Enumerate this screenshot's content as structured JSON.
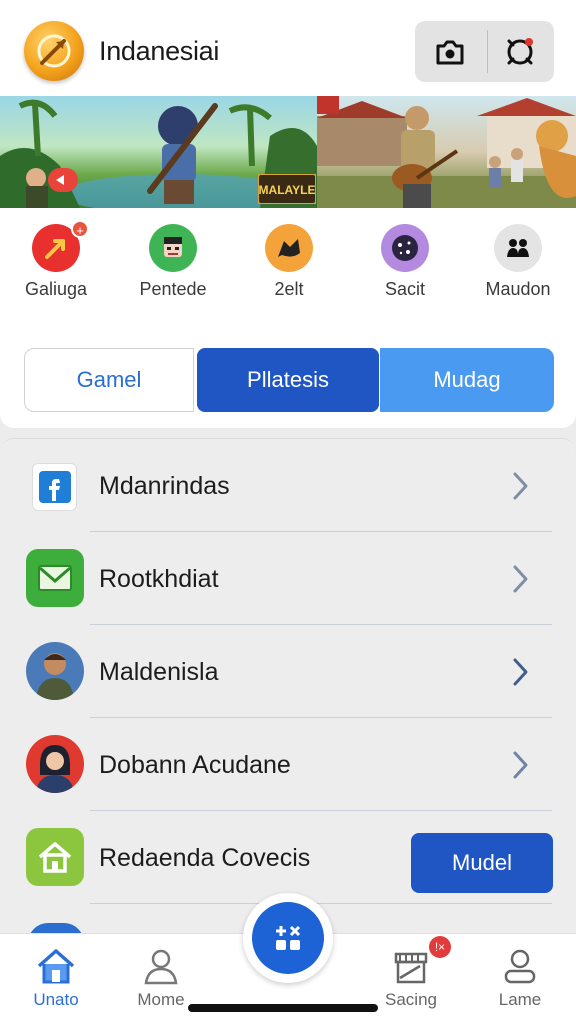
{
  "app": {
    "title": "Indanesiai"
  },
  "header": {
    "actions": [
      {
        "icon": "camera-icon"
      },
      {
        "icon": "record-icon"
      }
    ]
  },
  "banner": {
    "badge_text": "MALAYLE"
  },
  "quick_actions": [
    {
      "label": "Galiuga",
      "icon": "arrow-badge-icon",
      "color": "#e8302f",
      "badge": "+"
    },
    {
      "label": "Pentede",
      "icon": "character-icon",
      "color": "#3fb455"
    },
    {
      "label": "2elt",
      "icon": "fox-icon",
      "color": "#f3a33a"
    },
    {
      "label": "Sacit",
      "icon": "sparkle-icon",
      "color": "#b489e0"
    },
    {
      "label": "Maudon",
      "icon": "people-icon",
      "color": "#e4e4e4"
    }
  ],
  "tabs": [
    {
      "label": "Gamel"
    },
    {
      "label": "Pllatesis"
    },
    {
      "label": "Mudag"
    }
  ],
  "list": [
    {
      "label": "Mdanrindas",
      "icon": "facebook-icon"
    },
    {
      "label": "Rootkhdiat",
      "icon": "mail-icon"
    },
    {
      "label": "Maldenisla",
      "icon": "avatar-man-icon"
    },
    {
      "label": "Dobann Acudane",
      "icon": "avatar-woman-icon"
    },
    {
      "label": "Redaenda Covecis",
      "icon": "home-icon",
      "action": "Mudel"
    }
  ],
  "bottom_nav": [
    {
      "label": "Unato",
      "icon": "home-icon",
      "active": true
    },
    {
      "label": "Mome",
      "icon": "person-icon"
    },
    {
      "label": "Sacing",
      "icon": "store-icon",
      "badge": "!×"
    },
    {
      "label": "Lame",
      "icon": "user-icon"
    }
  ],
  "fab": {
    "icon": "grid-plus-icon"
  },
  "colors": {
    "primary": "#1f56c4",
    "accent": "#4a9af2",
    "link": "#2a6fd0"
  }
}
